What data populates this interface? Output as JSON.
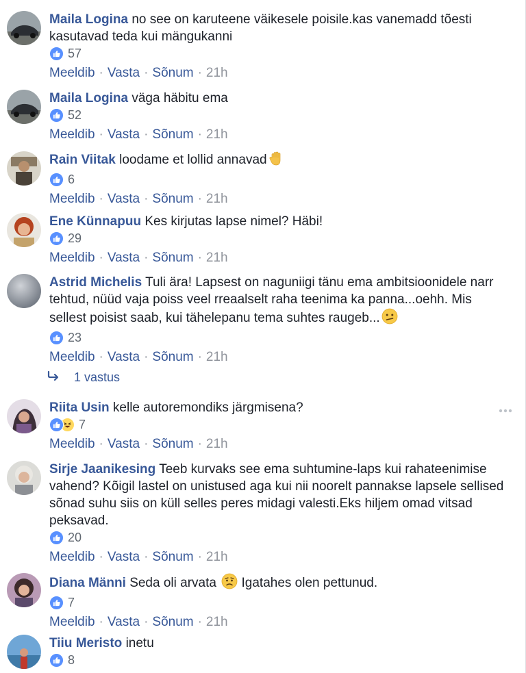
{
  "comments": [
    {
      "author": "Maila Logina",
      "text": "no see on karuteene väikesele poisile.kas vanemadd tõesti kasutavad teda kui mängukanni",
      "likes": "57",
      "actions": {
        "like": "Meeldib",
        "reply": "Vasta",
        "message": "Sõnum",
        "time": "21h"
      }
    },
    {
      "author": "Maila Logina",
      "text": "väga häbitu ema",
      "likes": "52",
      "actions": {
        "like": "Meeldib",
        "reply": "Vasta",
        "message": "Sõnum",
        "time": "21h"
      }
    },
    {
      "author": "Rain Viitak",
      "text": "loodame et lollid annavad",
      "emoji": "raised-hand",
      "likes": "6",
      "actions": {
        "like": "Meeldib",
        "reply": "Vasta",
        "message": "Sõnum",
        "time": "21h"
      }
    },
    {
      "author": "Ene Künnapuu",
      "text": "Kes kirjutas lapse nimel? Häbi!",
      "likes": "29",
      "actions": {
        "like": "Meeldib",
        "reply": "Vasta",
        "message": "Sõnum",
        "time": "21h"
      }
    },
    {
      "author": "Astrid Michelis",
      "text": "Tuli ära! Lapsest on naguniigi tänu ema ambitsioonidele narr tehtud, nüüd vaja poiss veel rreaalselt raha teenima ka panna...oehh. Mis sellest poisist saab, kui tähelepanu tema suhtes raugeb...",
      "emoji": "confused-face",
      "likes": "23",
      "actions": {
        "like": "Meeldib",
        "reply": "Vasta",
        "message": "Sõnum",
        "time": "21h"
      },
      "replies_label": "1 vastus"
    },
    {
      "author": "Riita Usin",
      "text": "kelle autoremondiks järgmisena?",
      "likes": "7",
      "reactions": [
        "like",
        "haha"
      ],
      "actions": {
        "like": "Meeldib",
        "reply": "Vasta",
        "message": "Sõnum",
        "time": "21h"
      }
    },
    {
      "author": "Sirje Jaanikesing",
      "text": "Teeb kurvaks see ema suhtumine-laps kui rahateenimise vahend? Kõigil lastel on unistused aga kui nii noorelt pannakse lapsele sellised sõnad suhu siis on küll selles peres midagi valesti.Eks hiljem omad vitsad peksavad.",
      "likes": "20",
      "actions": {
        "like": "Meeldib",
        "reply": "Vasta",
        "message": "Sõnum",
        "time": "21h"
      }
    },
    {
      "author": "Diana Männi",
      "text_before": "Seda oli arvata",
      "emoji": "worried-face",
      "text_after": "Igatahes olen pettunud.",
      "likes": "7",
      "actions": {
        "like": "Meeldib",
        "reply": "Vasta",
        "message": "Sõnum",
        "time": "21h"
      }
    },
    {
      "author": "Tiiu Meristo",
      "text": "inetu",
      "likes": "8"
    }
  ],
  "colors": {
    "author": "#385898",
    "meta": "#90949c",
    "like": "#5890ff",
    "text": "#1d2129"
  }
}
